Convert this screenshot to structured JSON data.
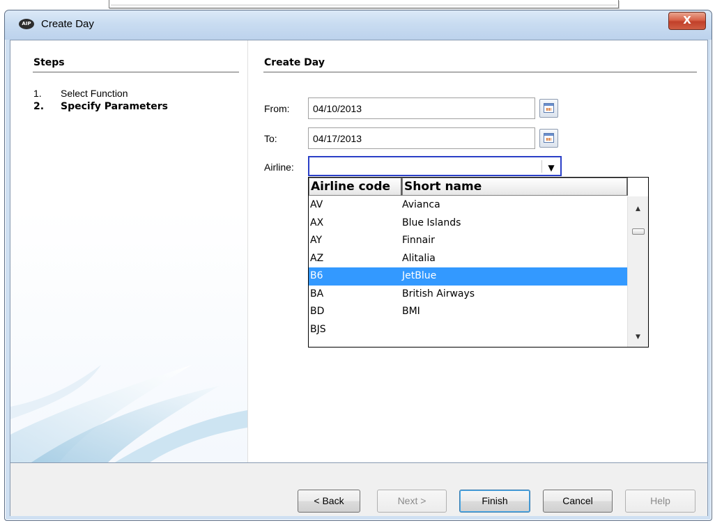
{
  "window": {
    "title": "Create Day",
    "icon_text": "AIP",
    "close_label": "X"
  },
  "steps": {
    "title": "Steps",
    "items": [
      {
        "num": "1.",
        "label": "Select Function"
      },
      {
        "num": "2.",
        "label": "Specify Parameters"
      }
    ]
  },
  "form": {
    "title": "Create Day",
    "from_label": "From:",
    "from_value": "04/10/2013",
    "to_label": "To:",
    "to_value": "04/17/2013",
    "airline_label": "Airline:",
    "airline_value": ""
  },
  "airline_list": {
    "headers": [
      "Airline code",
      "Short name"
    ],
    "rows": [
      {
        "code": "AV",
        "name": "Avianca"
      },
      {
        "code": "AX",
        "name": "Blue Islands"
      },
      {
        "code": "AY",
        "name": "Finnair"
      },
      {
        "code": "AZ",
        "name": "Alitalia"
      },
      {
        "code": "B6",
        "name": "JetBlue"
      },
      {
        "code": "BA",
        "name": "British Airways"
      },
      {
        "code": "BD",
        "name": "BMI"
      },
      {
        "code": "BJS",
        "name": ""
      }
    ],
    "selected_code": "B6"
  },
  "buttons": {
    "back": "< Back",
    "next": "Next >",
    "finish": "Finish",
    "cancel": "Cancel",
    "help": "Help"
  },
  "colors": {
    "selection": "#3399ff",
    "focus_border": "#2a3fc7",
    "close_button": "#c1402a"
  },
  "icons": [
    "app-icon",
    "close-icon",
    "calendar-icon",
    "chevron-down-icon",
    "scroll-up-icon",
    "scroll-down-icon"
  ]
}
